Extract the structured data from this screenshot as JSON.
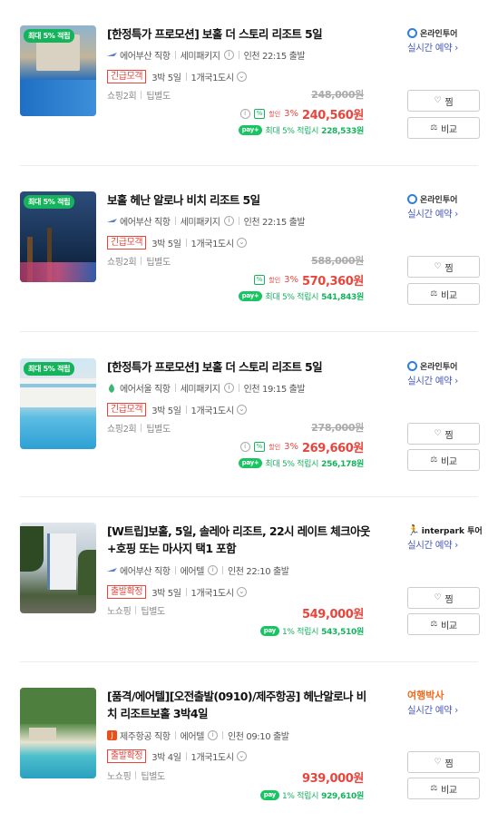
{
  "labels": {
    "wish": "찜",
    "compare": "비교",
    "realtime": "실시간 예약 ›",
    "max_point_prefix": "최대 5% 적립",
    "discount_label": "할인",
    "npay": "pay"
  },
  "items": [
    {
      "badge": "최대 5% 적립",
      "title": "[한정특가 프로모션] 보홀 더 스토리 리조트 5일",
      "airline": "에어부산 직항",
      "package_type": "세미패키지",
      "departure": "인천 22:15 출발",
      "status_tag": "긴급모객",
      "duration": "3박 5일",
      "countries": "1개국1도시",
      "shopping": "쇼핑2회",
      "tip": "팁별도",
      "original_price": "248,000원",
      "discount_rate": "3%",
      "final_price": "240,560원",
      "point_text": "최대 5% 적립시",
      "point_price": "228,533원",
      "vendor": "온라인투어",
      "colors": {
        "thumb_top": "#7aa6c9",
        "thumb_bottom": "#1c5fa8"
      }
    },
    {
      "badge": "최대 5% 적립",
      "title": "보홀 헤난 알로나 비치 리조트 5일",
      "airline": "에어부산 직항",
      "package_type": "세미패키지",
      "departure": "인천 22:15 출발",
      "status_tag": "긴급모객",
      "duration": "3박 5일",
      "countries": "1개국1도시",
      "shopping": "쇼핑2회",
      "tip": "팁별도",
      "original_price": "588,000원",
      "discount_rate": "3%",
      "final_price": "570,360원",
      "point_text": "최대 5% 적립시",
      "point_price": "541,843원",
      "vendor": "온라인투어",
      "colors": {
        "thumb_top": "#1f3d6b",
        "thumb_bottom": "#0e2340"
      }
    },
    {
      "badge": "최대 5% 적립",
      "title": "[한정특가 프로모션] 보홀 더 스토리 리조트 5일",
      "airline": "에어서울 직항",
      "package_type": "세미패키지",
      "departure": "인천 19:15 출발",
      "status_tag": "긴급모객",
      "duration": "3박 5일",
      "countries": "1개국1도시",
      "shopping": "쇼핑2회",
      "tip": "팁별도",
      "original_price": "278,000원",
      "discount_rate": "3%",
      "final_price": "269,660원",
      "point_text": "최대 5% 적립시",
      "point_price": "256,178원",
      "vendor": "온라인투어",
      "colors": {
        "thumb_top": "#b9e0f3",
        "thumb_bottom": "#3fa9d9"
      }
    },
    {
      "badge": "",
      "title": "[W트립]보홀, 5일, 솔레아 리조트, 22시 레이트 체크아웃+호핑 또는 마사지 택1 포함",
      "airline": "에어부산 직항",
      "package_type": "에어텔",
      "departure": "인천 22:10 출발",
      "status_tag": "출발확정",
      "duration": "3박 5일",
      "countries": "1개국1도시",
      "shopping": "노쇼핑",
      "tip": "팁별도",
      "original_price": "",
      "discount_rate": "",
      "final_price": "549,000원",
      "point_text": "1% 적립시",
      "point_price": "543,510원",
      "vendor": "interpark 투어",
      "colors": {
        "thumb_top": "#cfd8e0",
        "thumb_bottom": "#5d6b5a"
      }
    },
    {
      "badge": "",
      "title": "[품격/에어텔][오전출발(0910)/제주항공] 헤난알로나 비치 리조트보홀 3박4일",
      "airline": "제주항공 직항",
      "package_type": "에어텔",
      "departure": "인천 09:10 출발",
      "status_tag": "출발확정",
      "duration": "3박 4일",
      "countries": "1개국1도시",
      "shopping": "노쇼핑",
      "tip": "팁별도",
      "original_price": "",
      "discount_rate": "",
      "final_price": "939,000원",
      "point_text": "1% 적립시",
      "point_price": "929,610원",
      "vendor": "여행박사",
      "colors": {
        "thumb_top": "#6fa86a",
        "thumb_bottom": "#3cb6c4"
      }
    }
  ]
}
